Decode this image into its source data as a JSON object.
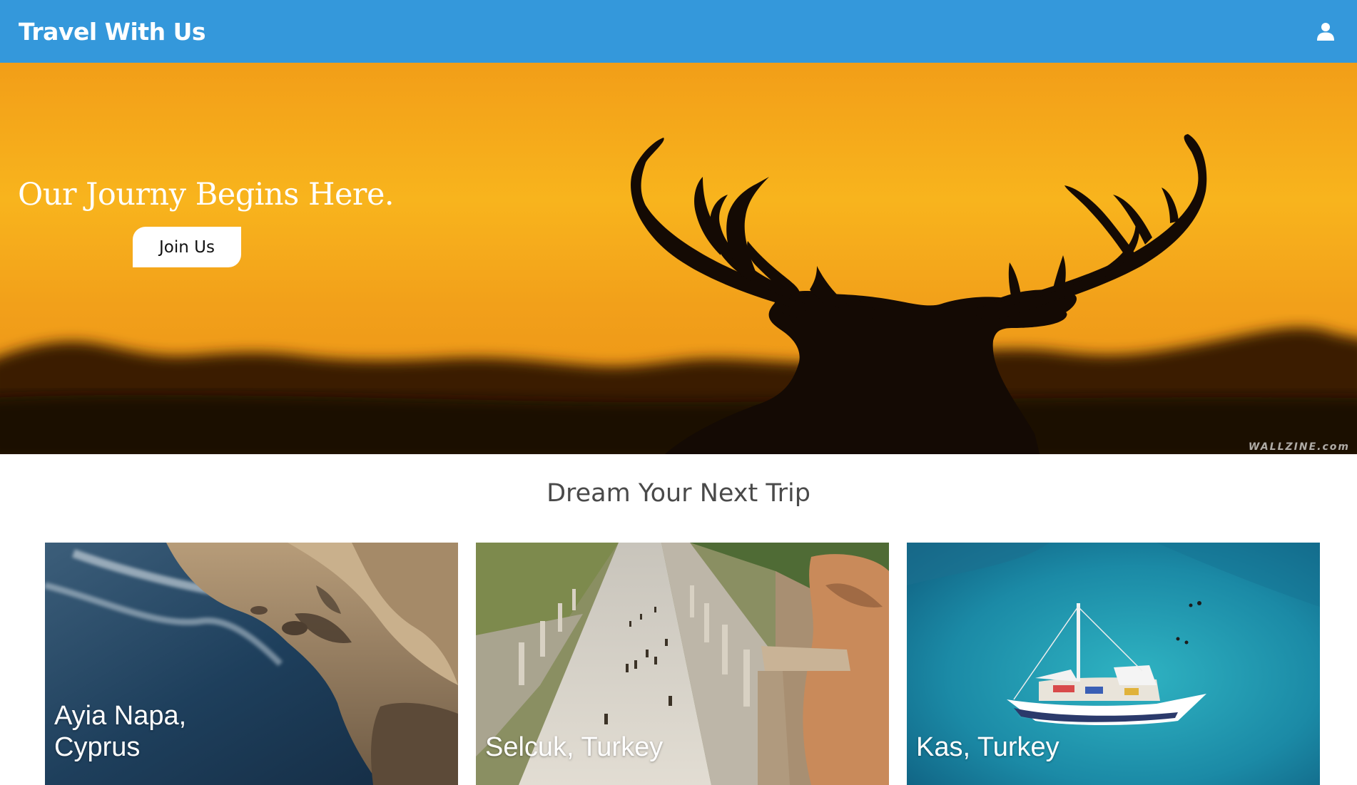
{
  "header": {
    "brand": "Travel With Us",
    "user_icon": "user-icon"
  },
  "hero": {
    "title": "Our Journy Begins Here.",
    "cta_label": "Join Us",
    "watermark": "WALLZINE.com"
  },
  "section": {
    "title": "Dream Your Next Trip"
  },
  "destinations": [
    {
      "label": "Ayia Napa, Cyprus"
    },
    {
      "label": "Selcuk, Turkey"
    },
    {
      "label": "Kas, Turkey"
    }
  ],
  "colors": {
    "navbar": "#3498db",
    "hero_sky": "#f7b01c",
    "text_white": "#ffffff",
    "section_title": "#4a4a4a"
  }
}
